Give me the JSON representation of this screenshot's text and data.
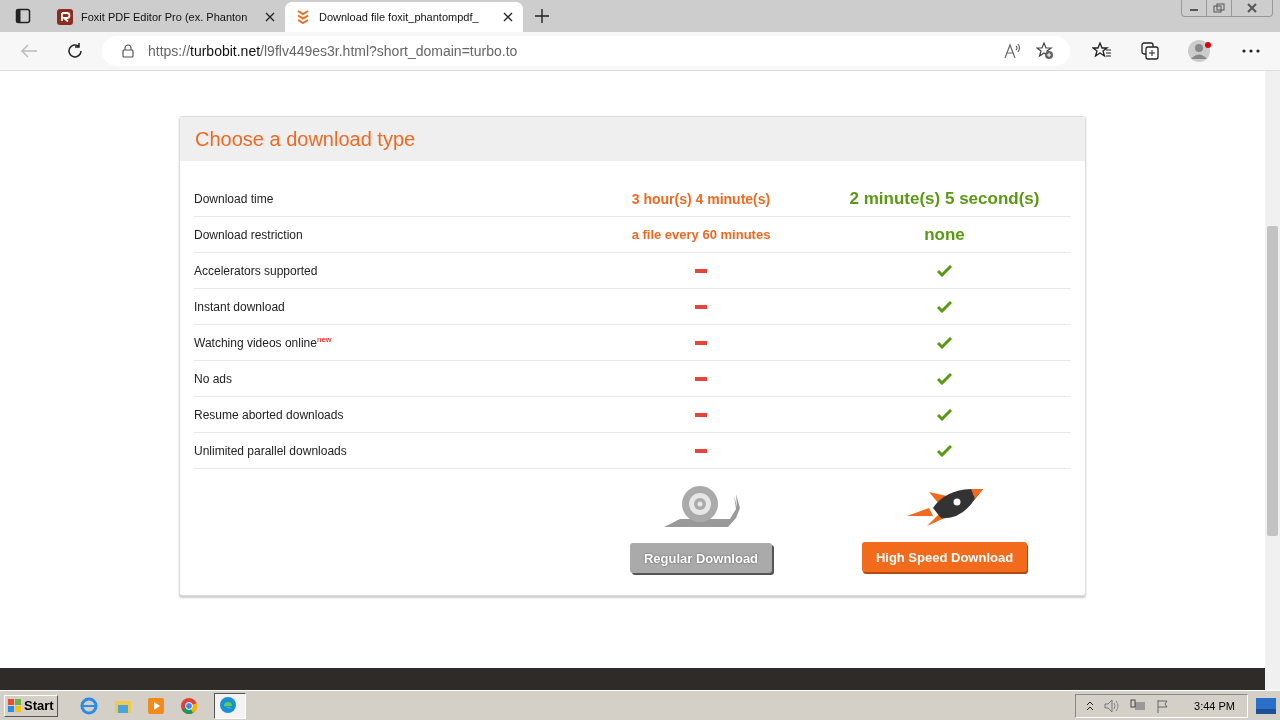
{
  "browser": {
    "tabs": [
      {
        "title": "Foxit PDF Editor Pro (ex. Phanton",
        "selected": false
      },
      {
        "title": "Download file foxit_phantompdf_",
        "selected": true
      }
    ],
    "url_host": "turbobit.net",
    "url_scheme": "https://",
    "url_path": "/l9flv449es3r.html?short_domain=turbo.to"
  },
  "card": {
    "title": "Choose a download type",
    "rows": [
      {
        "kind": "text",
        "label": "Download time",
        "regular": "3 hour(s) 4 minute(s)",
        "turbo": "2 minute(s) 5 second(s)"
      },
      {
        "kind": "text",
        "label": "Download restriction",
        "regular": "a file every 60 minutes",
        "turbo": "none"
      },
      {
        "kind": "feature",
        "label": "Accelerators supported",
        "regular": false,
        "turbo": true
      },
      {
        "kind": "feature",
        "label": "Instant download",
        "regular": false,
        "turbo": true
      },
      {
        "kind": "feature",
        "label": "Watching videos online$^{new}$",
        "regular": false,
        "turbo": true
      },
      {
        "kind": "feature",
        "label": "No ads",
        "regular": false,
        "turbo": true
      },
      {
        "kind": "feature",
        "label": "Resume aborted downloads",
        "regular": false,
        "turbo": true
      },
      {
        "kind": "feature",
        "label": "Unlimited parallel downloads",
        "regular": false,
        "turbo": true
      }
    ],
    "buttons": [
      "Regular Download",
      "High Speed Download"
    ]
  },
  "taskbar": {
    "start": "Start",
    "clock": "3:44 PM"
  }
}
